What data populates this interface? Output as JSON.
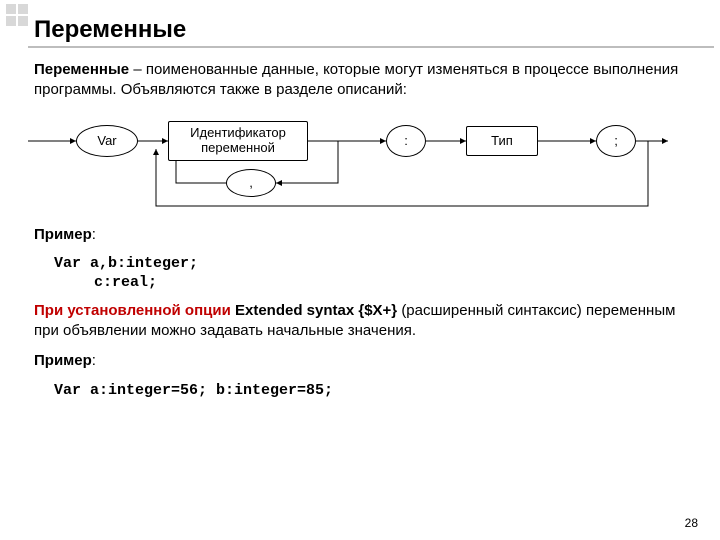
{
  "title": "Переменные",
  "para1_bold": "Переменные",
  "para1_rest": " – поименованные данные, которые могут изменяться в процессе выполнения программы. Объявляются также в разделе описаний:",
  "diagram": {
    "var": "Var",
    "ident_l1": "Идентификатор",
    "ident_l2": "переменной",
    "colon": ":",
    "type": "Тип",
    "semicolon": ";",
    "comma": ","
  },
  "example_label": "Пример",
  "example_colon": ":",
  "code1": "Var a,b:integer;",
  "code2": "c:real;",
  "extended_red": "При установленной опции",
  "extended_bold": " Extended syntax {$X+} ",
  "extended_rest": "(расширенный синтаксис) переменным при объявлении можно задавать начальные значения.",
  "code3": "Var a:integer=56; b:integer=85;",
  "pagenum": "28"
}
